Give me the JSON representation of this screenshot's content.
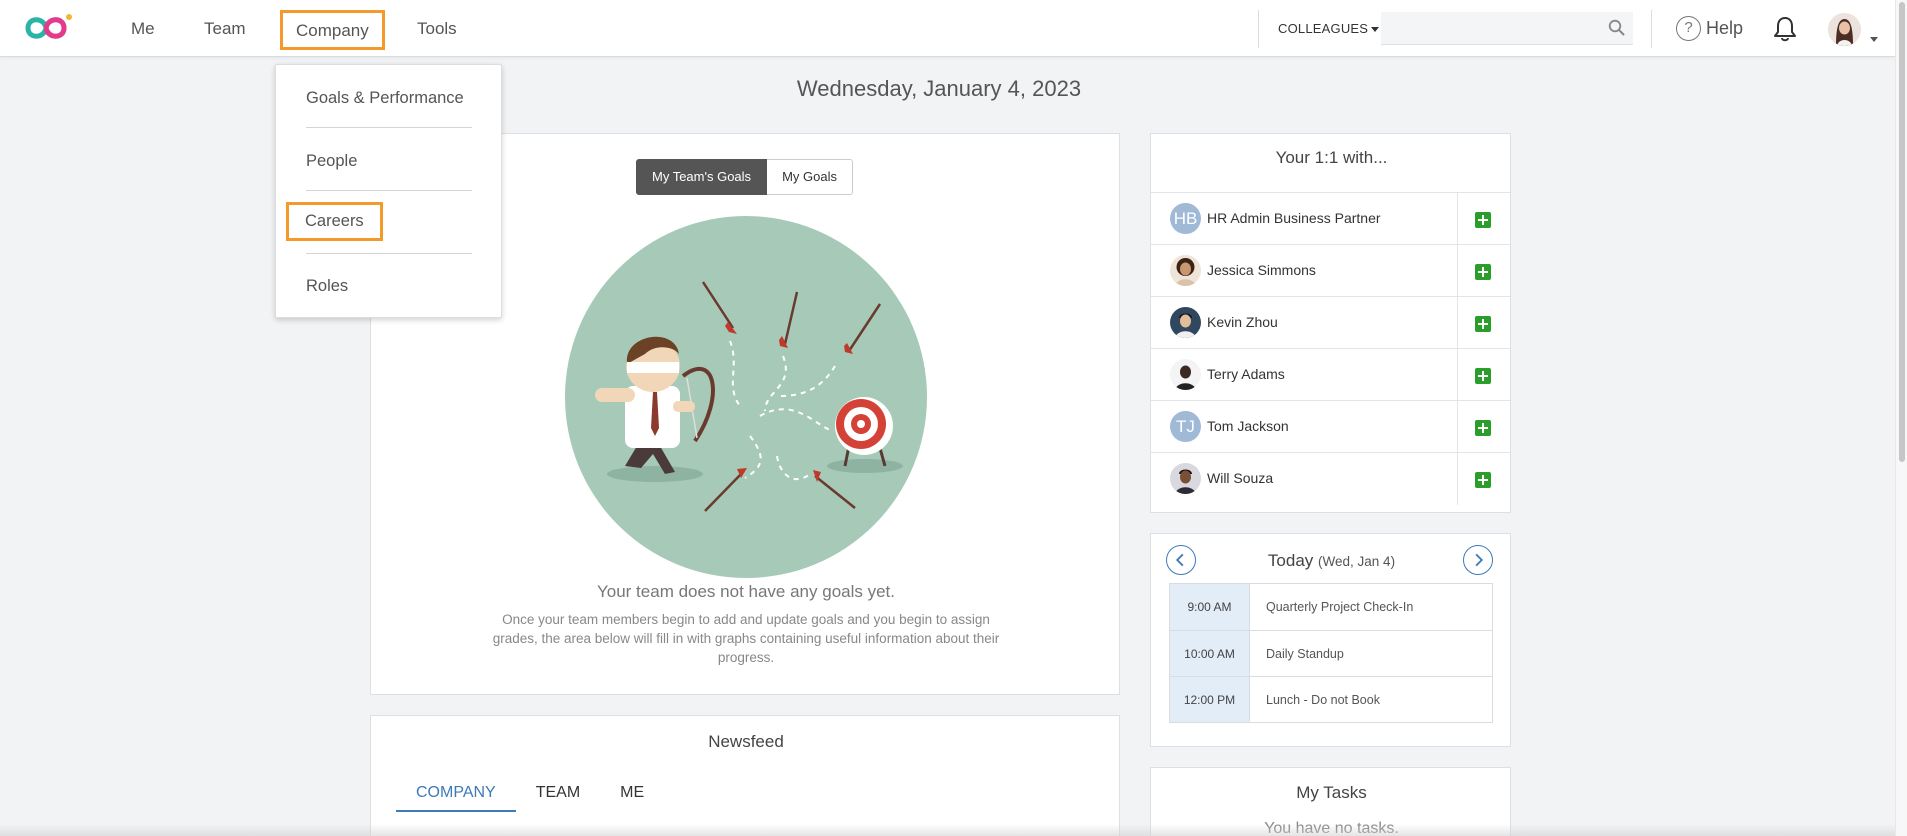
{
  "nav": {
    "items": [
      {
        "label": "Me"
      },
      {
        "label": "Team"
      },
      {
        "label": "Company"
      },
      {
        "label": "Tools"
      }
    ],
    "colleagues_label": "COLLEAGUES",
    "search_placeholder": "",
    "help_label": "Help",
    "help_glyph": "?"
  },
  "company_menu": {
    "items": [
      {
        "label": "Goals & Performance"
      },
      {
        "label": "People"
      },
      {
        "label": "Careers"
      },
      {
        "label": "Roles"
      }
    ]
  },
  "date_heading": "Wednesday, January 4, 2023",
  "goals": {
    "toggle_team": "My Team's Goals",
    "toggle_mine": "My Goals",
    "empty_title": "Your team does not have any goals yet.",
    "empty_desc": "Once your team members begin to add and update goals and you begin to assign grades, the area below will fill in with graphs containing useful information about their progress."
  },
  "newsfeed": {
    "title": "Newsfeed",
    "tabs": [
      {
        "label": "COMPANY"
      },
      {
        "label": "TEAM"
      },
      {
        "label": "ME"
      }
    ]
  },
  "one_on_one": {
    "title": "Your 1:1 with...",
    "people": [
      {
        "name": "HR Admin Business Partner",
        "initials": "HB",
        "avatar_color": "#9fb9d6"
      },
      {
        "name": "Jessica Simmons",
        "initials": "",
        "avatar_color": "#c9a27e"
      },
      {
        "name": "Kevin Zhou",
        "initials": "",
        "avatar_color": "#2f4860"
      },
      {
        "name": "Terry Adams",
        "initials": "",
        "avatar_color": "#3a3a3a"
      },
      {
        "name": "Tom Jackson",
        "initials": "TJ",
        "avatar_color": "#9fb9d6"
      },
      {
        "name": "Will Souza",
        "initials": "",
        "avatar_color": "#5a5a66"
      }
    ]
  },
  "calendar": {
    "title": "Today",
    "subtitle": "(Wed, Jan 4)",
    "events": [
      {
        "time": "9:00 AM",
        "title": "Quarterly Project Check-In"
      },
      {
        "time": "10:00 AM",
        "title": "Daily Standup"
      },
      {
        "time": "12:00 PM",
        "title": "Lunch - Do not Book"
      }
    ]
  },
  "tasks": {
    "title": "My Tasks",
    "empty": "You have no tasks."
  },
  "colors": {
    "highlight": "#f39a2b",
    "accent": "#3d7ab8",
    "add_green": "#2a9d2a",
    "illustration_bg": "#a6c9b8"
  }
}
